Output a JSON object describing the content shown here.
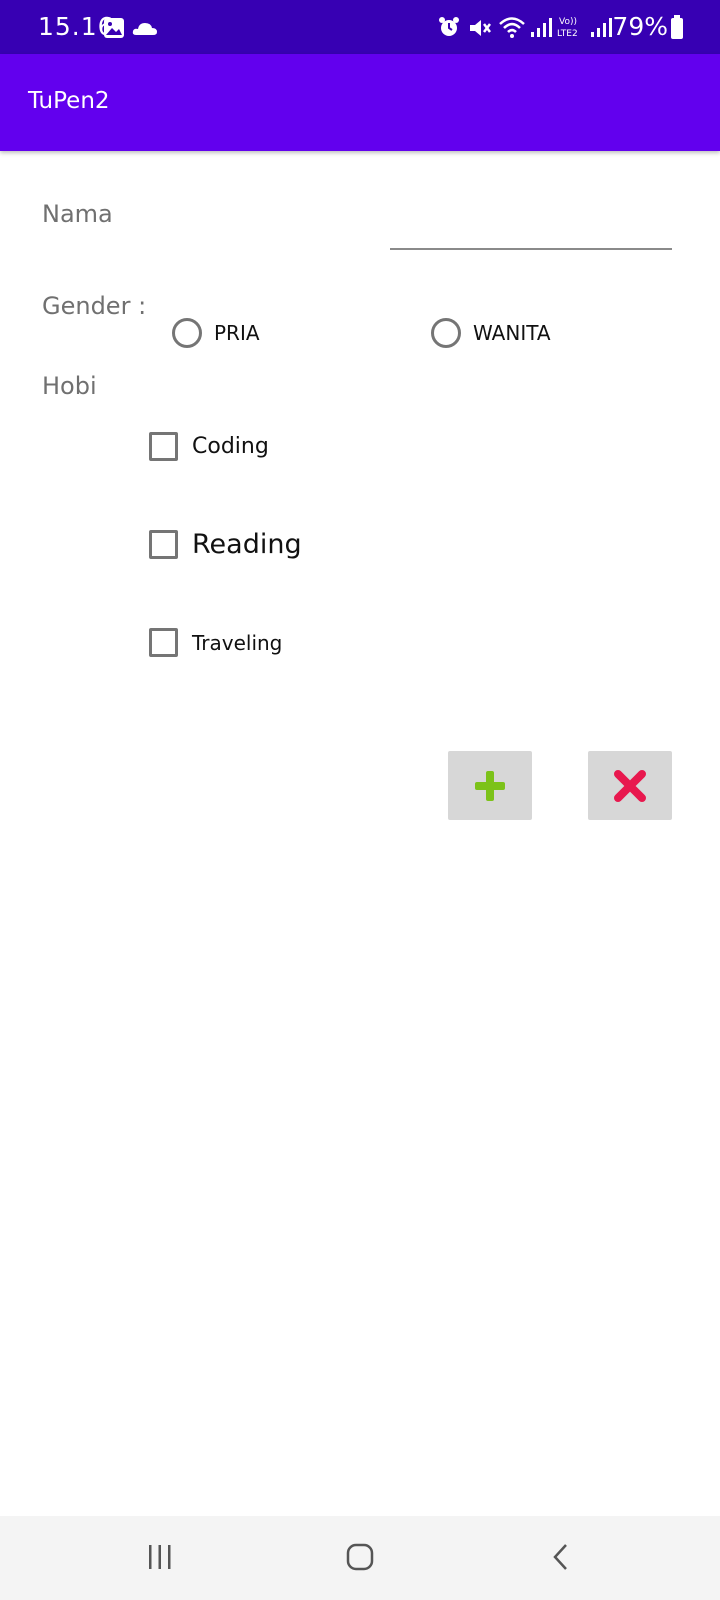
{
  "status_bar": {
    "time": "15.16",
    "battery": "79%",
    "icons": [
      "gallery-icon",
      "cloud-icon",
      "alarm-icon",
      "mute-icon",
      "wifi-icon",
      "signal-icon",
      "volte-icon",
      "signal-icon",
      "battery-icon"
    ]
  },
  "app_bar": {
    "title": "TuPen2"
  },
  "form": {
    "name_label": "Nama",
    "name_value": "",
    "gender_label": "Gender :",
    "gender_options": [
      "PRIA",
      "WANITA"
    ],
    "hobby_label": "Hobi",
    "hobbies": [
      "Coding",
      "Reading",
      "Traveling"
    ]
  },
  "actions": {
    "add_icon": "plus-icon",
    "cancel_icon": "close-icon",
    "add_color": "#7cc219",
    "cancel_color": "#e8184e"
  },
  "colors": {
    "status_bar": "#3700b3",
    "app_bar": "#6200ee"
  },
  "nav_bar": {
    "icons": [
      "recent-apps-icon",
      "home-icon",
      "back-icon"
    ]
  }
}
